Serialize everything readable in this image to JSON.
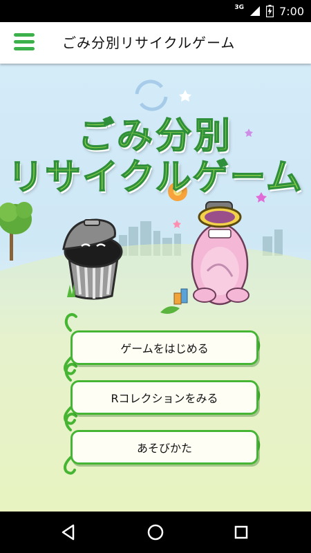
{
  "status_bar": {
    "network": "3G",
    "time": "7:00"
  },
  "app_bar": {
    "title": "ごみ分別リサイクルゲーム",
    "menu_icon": "hamburger-menu-icon"
  },
  "game_title": {
    "line1": "ごみ分別",
    "line2": "リサイクルゲーム"
  },
  "menu": {
    "start": "ゲームをはじめる",
    "collection": "Rコレクションをみる",
    "howto": "あそびかた"
  },
  "nav_bar": {
    "back_icon": "back-triangle-icon",
    "home_icon": "home-circle-icon",
    "recents_icon": "recents-square-icon"
  },
  "colors": {
    "accent_green": "#47b534",
    "title_green": "#8fd44a",
    "title_outline": "#2f8f3a",
    "menu_icon_green": "#3bb04b"
  }
}
